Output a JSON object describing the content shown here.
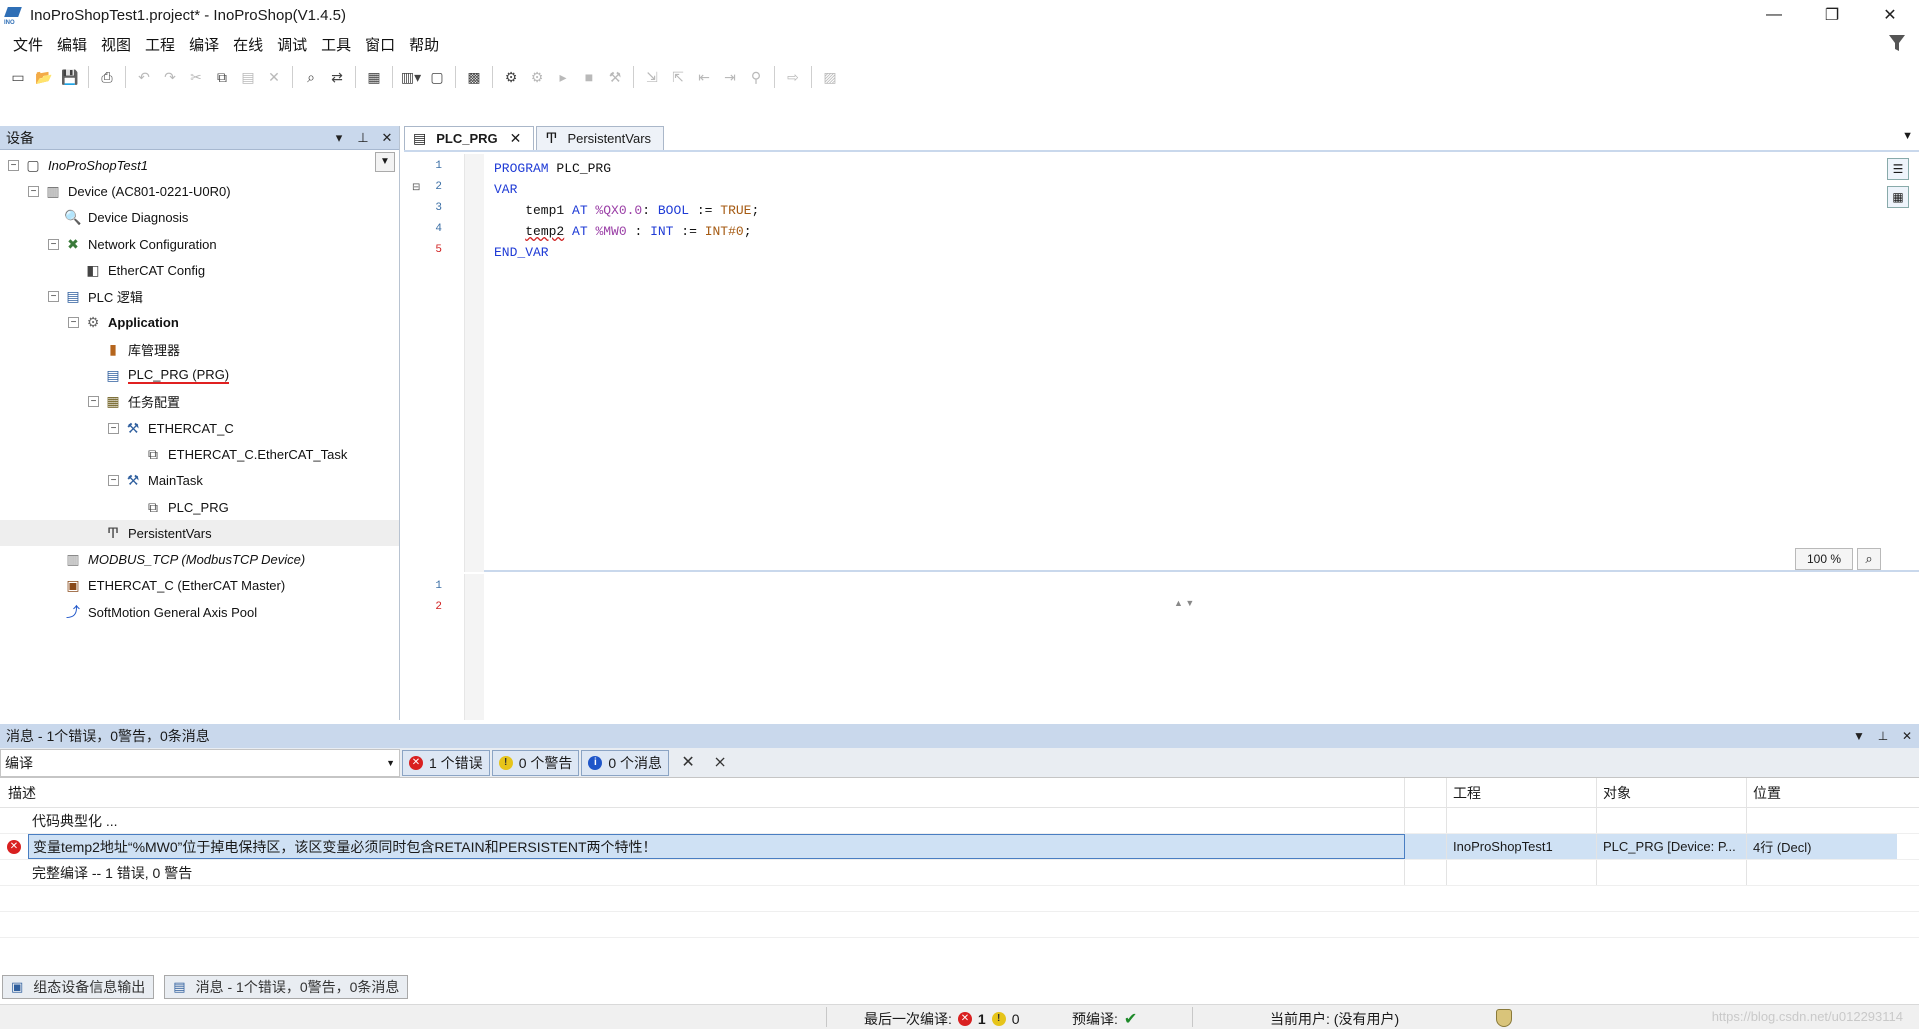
{
  "window": {
    "title": "InoProShopTest1.project* - InoProShop(V1.4.5)",
    "controls": [
      "—",
      "❐",
      "✕"
    ]
  },
  "menu": [
    "文件",
    "编辑",
    "视图",
    "工程",
    "编译",
    "在线",
    "调试",
    "工具",
    "窗口",
    "帮助"
  ],
  "toolbar_icons": [
    "new-file-icon",
    "open-icon",
    "save-icon",
    "print-icon",
    "undo-icon",
    "redo-icon",
    "cut-icon",
    "copy-icon",
    "paste-icon",
    "delete-icon",
    "find-icon",
    "replace-icon",
    "browse-icon",
    "add-object-icon",
    "properties-icon",
    "build-icon",
    "login-icon",
    "logout-icon",
    "start-icon",
    "stop-icon",
    "reset-icon",
    "step-icon",
    "breakpoint-icon",
    "settings-icon"
  ],
  "device_panel": {
    "title": "设备",
    "tree": [
      {
        "label": "InoProShopTest1",
        "level": 0,
        "icon": "project-icon",
        "exp": "−",
        "style": "italic"
      },
      {
        "label": "Device (AC801-0221-U0R0)",
        "level": 1,
        "icon": "device-icon",
        "exp": "−"
      },
      {
        "label": "Device Diagnosis",
        "level": 2,
        "icon": "diagnosis-icon",
        "exp": ""
      },
      {
        "label": "Network Configuration",
        "level": 2,
        "icon": "network-icon",
        "exp": "−"
      },
      {
        "label": "EtherCAT Config",
        "level": 3,
        "icon": "ethercat-config-icon",
        "exp": ""
      },
      {
        "label": "PLC 逻辑",
        "level": 2,
        "icon": "plc-logic-icon",
        "exp": "−"
      },
      {
        "label": "Application",
        "level": 3,
        "icon": "application-icon",
        "exp": "−",
        "style": "bold"
      },
      {
        "label": "库管理器",
        "level": 4,
        "icon": "library-icon",
        "exp": ""
      },
      {
        "label": "PLC_PRG (PRG)",
        "level": 4,
        "icon": "pou-icon",
        "exp": "",
        "style": "underline-red"
      },
      {
        "label": "任务配置",
        "level": 4,
        "icon": "task-config-icon",
        "exp": "−"
      },
      {
        "label": "ETHERCAT_C",
        "level": 5,
        "icon": "task-icon",
        "exp": "−"
      },
      {
        "label": "ETHERCAT_C.EtherCAT_Task",
        "level": 6,
        "icon": "task-call-icon",
        "exp": ""
      },
      {
        "label": "MainTask",
        "level": 5,
        "icon": "task-icon",
        "exp": "−"
      },
      {
        "label": "PLC_PRG",
        "level": 6,
        "icon": "task-call-icon",
        "exp": ""
      },
      {
        "label": "PersistentVars",
        "level": 4,
        "icon": "persistent-vars-icon",
        "exp": "",
        "selected": true
      },
      {
        "label": "MODBUS_TCP (ModbusTCP Device)",
        "level": 2,
        "icon": "modbus-icon",
        "exp": "",
        "style": "italic"
      },
      {
        "label": "ETHERCAT_C (EtherCAT Master)",
        "level": 2,
        "icon": "ethercat-master-icon",
        "exp": ""
      },
      {
        "label": "SoftMotion General Axis Pool",
        "level": 2,
        "icon": "axis-pool-icon",
        "exp": ""
      }
    ]
  },
  "editor": {
    "tabs": [
      {
        "label": "PLC_PRG",
        "active": true
      },
      {
        "label": "PersistentVars",
        "active": false
      }
    ],
    "line_numbers_top": [
      "1",
      "2",
      "3",
      "4",
      "5"
    ],
    "line_numbers_bottom": [
      "1",
      "2"
    ],
    "code_lines": [
      [
        {
          "t": "PROGRAM",
          "c": "kw"
        },
        {
          "t": " PLC_PRG",
          "c": "var"
        }
      ],
      [
        {
          "t": "VAR",
          "c": "kw"
        }
      ],
      [
        {
          "t": "    temp1 ",
          "c": "var"
        },
        {
          "t": "AT",
          "c": "kw"
        },
        {
          "t": " %QX0.0",
          "c": "addr"
        },
        {
          "t": ": ",
          "c": "var"
        },
        {
          "t": "BOOL",
          "c": "kw"
        },
        {
          "t": " := ",
          "c": "var"
        },
        {
          "t": "TRUE",
          "c": "num"
        },
        {
          "t": ";",
          "c": "var"
        }
      ],
      [
        {
          "t": "    ",
          "c": "var"
        },
        {
          "t": "temp2",
          "c": "var err-underline"
        },
        {
          "t": " ",
          "c": "var"
        },
        {
          "t": "AT",
          "c": "kw"
        },
        {
          "t": " %MW0",
          "c": "addr"
        },
        {
          "t": " : ",
          "c": "var"
        },
        {
          "t": "INT",
          "c": "kw"
        },
        {
          "t": " := ",
          "c": "var"
        },
        {
          "t": "INT#0",
          "c": "num"
        },
        {
          "t": ";",
          "c": "var"
        }
      ],
      [
        {
          "t": "END_VAR",
          "c": "kw"
        }
      ]
    ],
    "zoom": "100 %"
  },
  "messages": {
    "title": "消息 - 1个错误，0警告，0条消息",
    "category": "编译",
    "filters": {
      "errors": "1 个错误",
      "warnings": "0 个警告",
      "infos": "0 个消息"
    },
    "columns": {
      "desc": "描述",
      "project": "工程",
      "object": "对象",
      "position": "位置"
    },
    "rows": [
      {
        "desc": "代码典型化 ...",
        "project": "",
        "object": "",
        "position": "",
        "error": false,
        "selected": false
      },
      {
        "desc": "变量temp2地址“%MW0”位于掉电保持区，该区变量必须同时包含RETAIN和PERSISTENT两个特性！",
        "project": "InoProShopTest1",
        "object": "PLC_PRG [Device: P...",
        "position": "4行 (Decl)",
        "error": true,
        "selected": true
      },
      {
        "desc": "完整编译 -- 1 错误, 0 警告",
        "project": "",
        "object": "",
        "position": "",
        "error": false,
        "selected": false
      }
    ]
  },
  "bottom_tabs": [
    "组态设备信息输出",
    "消息 - 1个错误，0警告，0条消息"
  ],
  "status": {
    "last_compile_label": "最后一次编译:",
    "errors": "1",
    "warnings": "0",
    "precompile_label": "预编译:",
    "user_label": "当前用户: (没有用户)",
    "watermark": "https://blog.csdn.net/u012293114"
  }
}
